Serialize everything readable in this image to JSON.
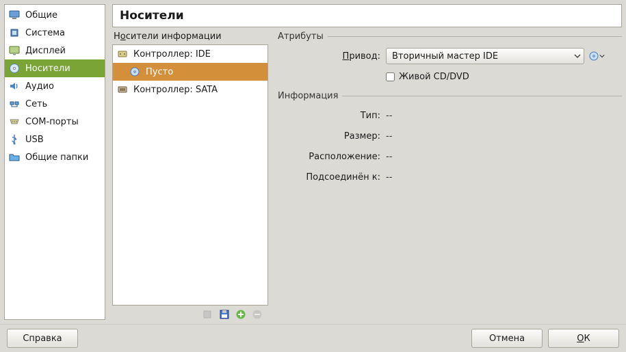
{
  "sidebar": {
    "items": [
      {
        "label": "Общие",
        "icon": "monitor"
      },
      {
        "label": "Система",
        "icon": "chip"
      },
      {
        "label": "Дисплей",
        "icon": "display"
      },
      {
        "label": "Носители",
        "icon": "disc",
        "selected": true
      },
      {
        "label": "Аудио",
        "icon": "audio"
      },
      {
        "label": "Сеть",
        "icon": "net"
      },
      {
        "label": "COM-порты",
        "icon": "serial"
      },
      {
        "label": "USB",
        "icon": "usb"
      },
      {
        "label": "Общие папки",
        "icon": "folder"
      }
    ]
  },
  "page": {
    "title": "Носители"
  },
  "tree": {
    "title_pre": "Н",
    "title_ul": "о",
    "title_post": "сители информации",
    "items": [
      {
        "label": "Контроллер: IDE",
        "icon": "ide",
        "level": 1
      },
      {
        "label": "Пусто",
        "icon": "cd",
        "level": 2,
        "selected": true
      },
      {
        "label": "Контроллер: SATA",
        "icon": "sata",
        "level": 1
      }
    ],
    "toolbar": [
      {
        "name": "add-controller",
        "icon": "add-ctrl",
        "disabled": true
      },
      {
        "name": "remove-controller",
        "icon": "floppy",
        "disabled": false
      },
      {
        "name": "add-attachment",
        "icon": "add-green",
        "disabled": false
      },
      {
        "name": "remove-attachment",
        "icon": "remove-grey",
        "disabled": true
      }
    ]
  },
  "details": {
    "attrs_label": "Атрибуты",
    "drive_label_pre": "",
    "drive_label_ul": "П",
    "drive_label_post": "ривод:",
    "drive_value": "Вторичный мастер IDE",
    "live_cd_label": "Живой CD/DVD",
    "live_cd_checked": false,
    "info_label": "Информация",
    "rows": [
      {
        "label": "Тип:",
        "value": "--"
      },
      {
        "label": "Размер:",
        "value": "--"
      },
      {
        "label": "Расположение:",
        "value": "--"
      },
      {
        "label": "Подсоединён к:",
        "value": "--"
      }
    ]
  },
  "buttons": {
    "help": "Справка",
    "cancel": "Отмена",
    "ok_pre": "",
    "ok_ul": "О",
    "ok_post": "К"
  }
}
